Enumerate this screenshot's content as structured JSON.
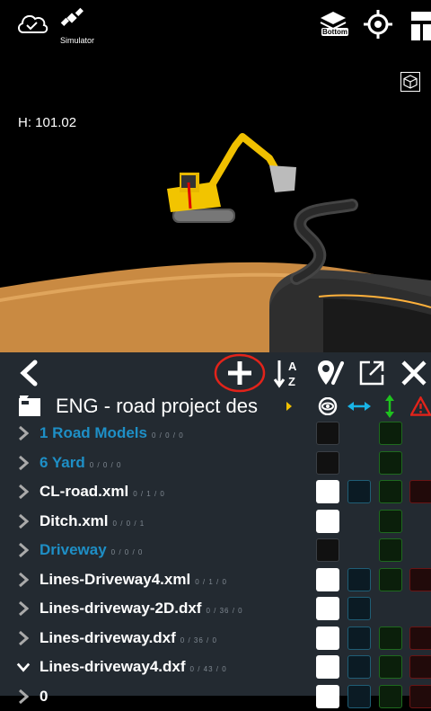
{
  "viewport": {
    "simulator_label": "Simulator",
    "height_readout": "H: 101.02",
    "layer_toggle_label": "Bottom",
    "icons": [
      "cloud-check-icon",
      "satellite-icon",
      "layers-icon",
      "target-icon",
      "panel-icon",
      "cube-icon"
    ]
  },
  "toolbar": {
    "icons": [
      "chevron-left-icon",
      "add-icon",
      "sort-az-icon",
      "pin-edit-icon",
      "open-external-icon",
      "close-icon"
    ]
  },
  "project": {
    "name": "ENG - road project des",
    "column_icons": [
      "eye-icon",
      "horizontal-arrows-icon",
      "vertical-arrows-icon",
      "warning-icon"
    ]
  },
  "layers": [
    {
      "name": "1 Road Models",
      "counts": "0 / 0 / 0",
      "folder": true,
      "expanded": false,
      "visible": false,
      "h": false,
      "v": true,
      "w": false
    },
    {
      "name": "6 Yard",
      "counts": "0 / 0 / 0",
      "folder": true,
      "expanded": false,
      "visible": false,
      "h": false,
      "v": true,
      "w": false
    },
    {
      "name": "CL-road.xml",
      "counts": "0 / 1 / 0",
      "folder": false,
      "expanded": false,
      "visible": true,
      "h": true,
      "v": true,
      "w": true
    },
    {
      "name": "Ditch.xml",
      "counts": "0 / 0 / 1",
      "folder": false,
      "expanded": false,
      "visible": true,
      "h": false,
      "v": true,
      "w": false
    },
    {
      "name": "Driveway",
      "counts": "0 / 0 / 0",
      "folder": true,
      "expanded": false,
      "visible": false,
      "h": false,
      "v": true,
      "w": false
    },
    {
      "name": "Lines-Driveway4.xml",
      "counts": "0 / 1 / 0",
      "folder": false,
      "expanded": false,
      "visible": true,
      "h": true,
      "v": true,
      "w": true
    },
    {
      "name": "Lines-driveway-2D.dxf",
      "counts": "0 / 36 / 0",
      "folder": false,
      "expanded": false,
      "visible": true,
      "h": true,
      "v": false,
      "w": false
    },
    {
      "name": "Lines-driveway.dxf",
      "counts": "0 / 36 / 0",
      "folder": false,
      "expanded": false,
      "visible": true,
      "h": true,
      "v": true,
      "w": true
    },
    {
      "name": "Lines-driveway4.dxf",
      "counts": "0 / 43 / 0",
      "folder": false,
      "expanded": true,
      "visible": true,
      "h": true,
      "v": true,
      "w": true
    },
    {
      "name": "0",
      "counts": "",
      "folder": false,
      "expanded": false,
      "visible": true,
      "h": true,
      "v": true,
      "w": true
    }
  ]
}
